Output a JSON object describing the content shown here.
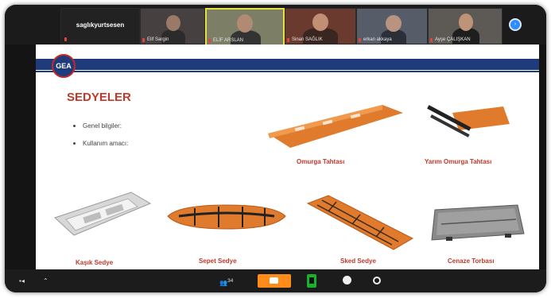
{
  "meeting": {
    "participants": [
      {
        "name": "saglıkyurtsesen",
        "mic_muted": false
      },
      {
        "name": "Elif Sargin",
        "mic_muted": true
      },
      {
        "name": "ELİF ARSLAN",
        "mic_muted": true
      },
      {
        "name": "Sinan SAĞLIK",
        "mic_muted": true
      },
      {
        "name": "erkan akkaya",
        "mic_muted": true
      },
      {
        "name": "Ayşe ÇALIŞKAN",
        "mic_muted": true
      }
    ],
    "participant_count": "34",
    "colors": {
      "zoom_blue": "#2d8cff",
      "chat_orange": "#ff8c1a",
      "share_green": "#17b12b",
      "mic_red": "#e0463e"
    }
  },
  "slide": {
    "logo_text": "GEA",
    "title": "SEDYELER",
    "bullets": [
      "Genel bilgiler:",
      "Kullanım amacı:"
    ],
    "items": {
      "omurga": "Omurga Tahtası",
      "yarim": "Yarım Omurga Tahtası",
      "kasik": "Kaşık Sedye",
      "sepet": "Sepet Sedye",
      "sked": "Sked Sedye",
      "cenaze": "Cenaze Torbası"
    },
    "colors": {
      "title_red": "#c0392b",
      "bar_blue": "#1f3b7a",
      "stretcher_orange": "#e07a2c"
    }
  },
  "toolbar": {
    "icons": [
      "more-icon",
      "chevron-up-icon",
      "participants-icon",
      "chat-icon",
      "share-screen-icon",
      "record-icon",
      "reactions-icon"
    ]
  }
}
